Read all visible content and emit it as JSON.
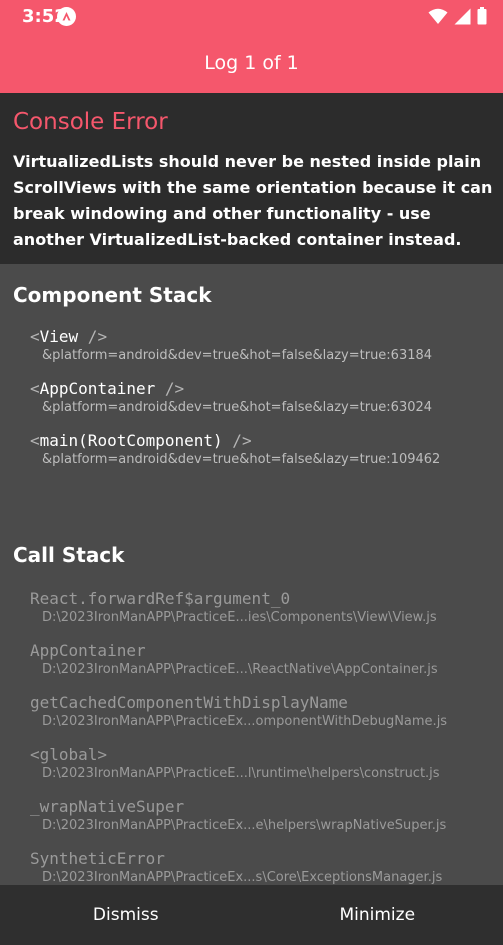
{
  "status_bar": {
    "time": "3:52",
    "icons": [
      "app-badge-icon",
      "wifi-icon",
      "signal-icon",
      "battery-icon"
    ]
  },
  "header": {
    "title": "Log 1 of 1"
  },
  "error": {
    "title": "Console Error",
    "message": "VirtualizedLists should never be nested inside plain ScrollViews with the same orientation because it can break windowing and other functionality - use another VirtualizedList-backed container instead."
  },
  "component_stack": {
    "title": "Component Stack",
    "items": [
      {
        "open": "<",
        "name": "View",
        "close": " />",
        "location": "&platform=android&dev=true&hot=false&lazy=true:63184"
      },
      {
        "open": "<",
        "name": "AppContainer",
        "close": " />",
        "location": "&platform=android&dev=true&hot=false&lazy=true:63024"
      },
      {
        "open": "<",
        "name": "main(RootComponent)",
        "close": " />",
        "location": "&platform=android&dev=true&hot=false&lazy=true:109462"
      }
    ]
  },
  "call_stack": {
    "title": "Call Stack",
    "frames": [
      {
        "name": "React.forwardRef$argument_0",
        "location": "D:\\2023IronManAPP\\PracticeE...ies\\Components\\View\\View.js"
      },
      {
        "name": "AppContainer",
        "location": "D:\\2023IronManAPP\\PracticeE...\\ReactNative\\AppContainer.js"
      },
      {
        "name": "getCachedComponentWithDisplayName",
        "location": "D:\\2023IronManAPP\\PracticeEx...omponentWithDebugName.js"
      },
      {
        "name": "<global>",
        "location": "D:\\2023IronManAPP\\PracticeE...l\\runtime\\helpers\\construct.js"
      },
      {
        "name": "_wrapNativeSuper",
        "location": "D:\\2023IronManAPP\\PracticeEx...e\\helpers\\wrapNativeSuper.js"
      },
      {
        "name": "SyntheticError",
        "location": "D:\\2023IronManAPP\\PracticeEx...s\\Core\\ExceptionsManager.js"
      }
    ]
  },
  "footer": {
    "dismiss_label": "Dismiss",
    "minimize_label": "Minimize"
  },
  "colors": {
    "accent": "#f5576c",
    "error_bg": "#2c2c2c",
    "content_bg": "#4b4b4b",
    "footer_bg": "#2f2f2f"
  }
}
